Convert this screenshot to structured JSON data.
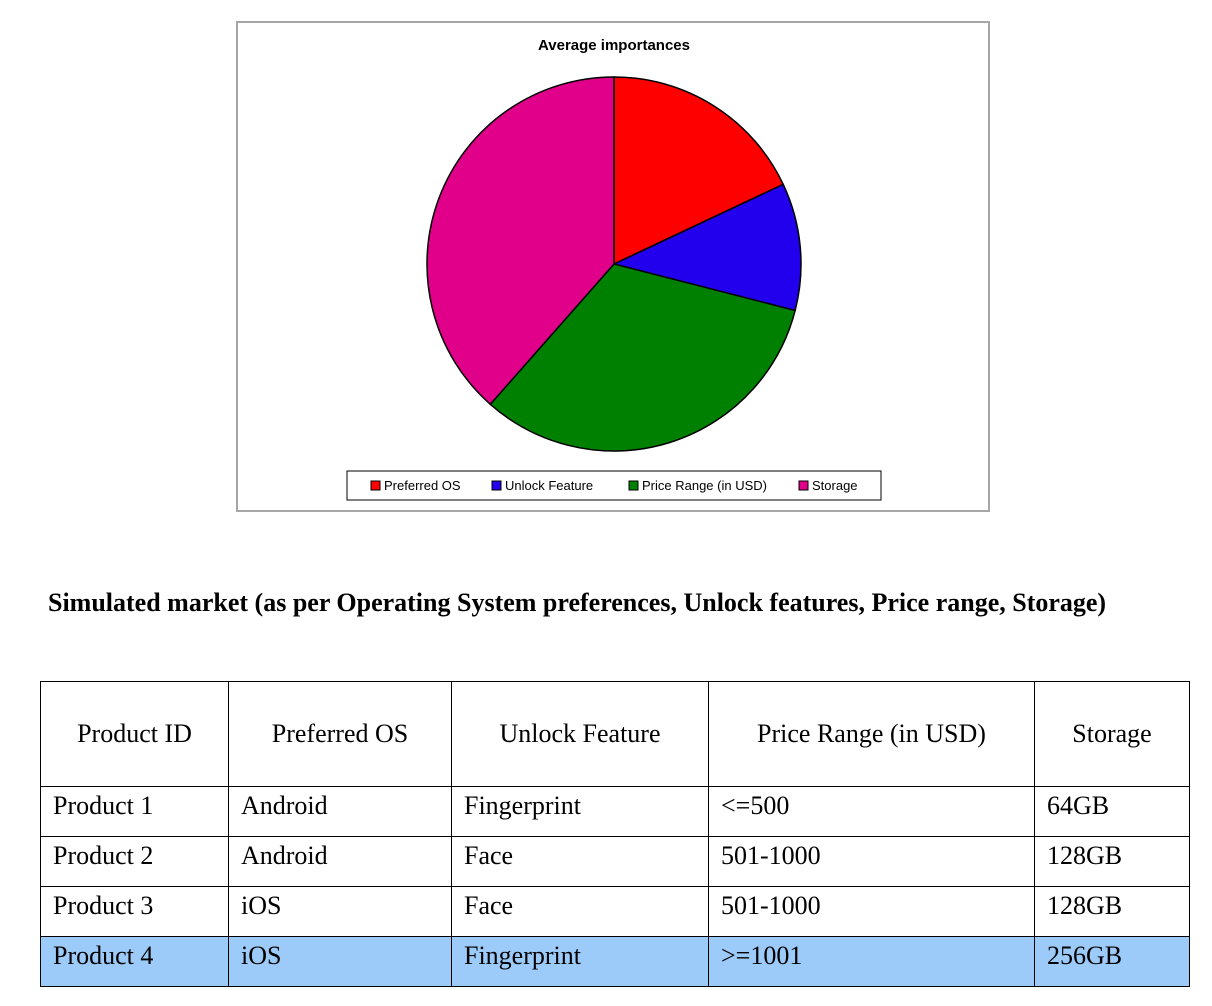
{
  "chart_data": {
    "type": "pie",
    "title": "Average importances",
    "categories": [
      "Preferred OS",
      "Unlock Feature",
      "Price Range (in USD)",
      "Storage"
    ],
    "values": [
      18.0,
      11.0,
      32.5,
      38.5
    ],
    "colors": [
      "#ff0000",
      "#2200ee",
      "#008000",
      "#e0008a"
    ],
    "start_angle_deg": 0,
    "direction": "clockwise",
    "legend_position": "bottom"
  },
  "section": {
    "heading": "Simulated market (as per Operating System preferences, Unlock features, Price range, Storage)"
  },
  "table": {
    "headers": [
      "Product ID",
      "Preferred OS",
      "Unlock Feature",
      "Price Range (in USD)",
      "Storage"
    ],
    "rows": [
      [
        "Product 1",
        "Android",
        "Fingerprint",
        "<=500",
        "64GB"
      ],
      [
        "Product 2",
        "Android",
        "Face",
        "501-1000",
        "128GB"
      ],
      [
        "Product 3",
        "iOS",
        "Face",
        "501-1000",
        "128GB"
      ],
      [
        "Product 4",
        "iOS",
        "Fingerprint",
        ">=1001",
        "256GB"
      ]
    ],
    "highlight_color": "#9ccaf9"
  }
}
